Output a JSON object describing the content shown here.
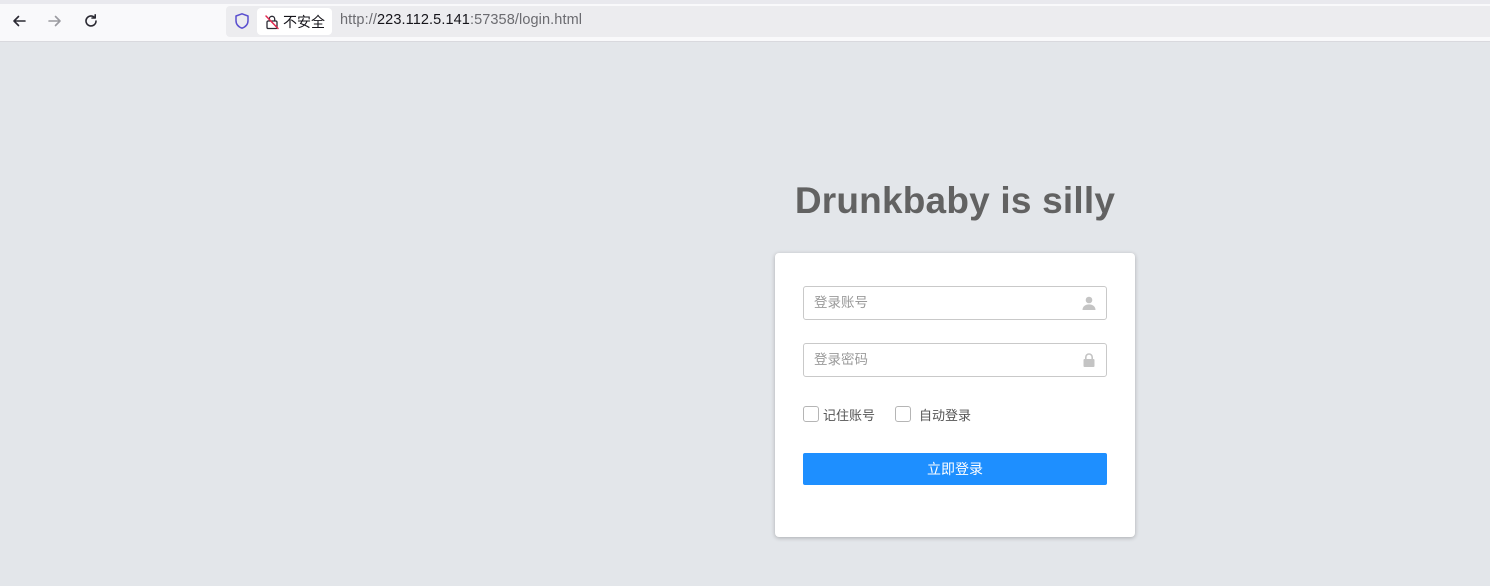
{
  "browser": {
    "security_label": "不安全",
    "url_scheme": "http://",
    "url_host": "223.112.5.141",
    "url_rest": ":57358/login.html"
  },
  "page": {
    "title": "Drunkbaby is silly"
  },
  "login": {
    "username_placeholder": "登录账号",
    "password_placeholder": "登录密码",
    "remember_label": "记住账号",
    "auto_login_label": "自动登录",
    "submit_label": "立即登录"
  },
  "colors": {
    "background": "#e3e6ea",
    "primary_button": "#1e8fff",
    "title_text": "#626262"
  },
  "icons": {
    "back": "back-arrow-icon",
    "forward": "forward-arrow-icon",
    "reload": "reload-icon",
    "tracking": "shield-icon",
    "insecure": "insecure-lock-icon",
    "user": "user-icon",
    "password": "lock-icon"
  }
}
